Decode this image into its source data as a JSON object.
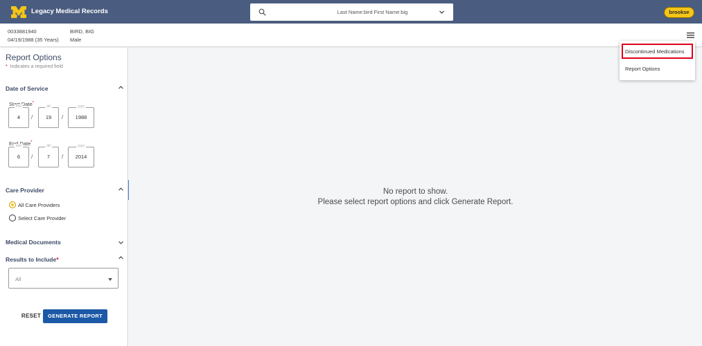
{
  "header": {
    "app_title": "Legacy Medical Records",
    "search_text": "Last Name:bird First Name:big",
    "user": "brookse",
    "colors": {
      "bar": "#4a5d80",
      "badge": "#f5c518"
    }
  },
  "patient": {
    "mrn": "0033881940",
    "name": "BIRD, BIG",
    "dob_age": "04/19/1988 (35 Years)",
    "sex": "Male"
  },
  "menu": {
    "items": [
      "Discontinued Medications",
      "Report Options"
    ],
    "highlighted_index": 0
  },
  "report_options": {
    "title": "Report Options",
    "required_note": "Indicates a required field",
    "date_of_service": {
      "title": "Date of Service",
      "start_label": "Start Date",
      "end_label": "End Date",
      "placeholders": {
        "mm": "mm",
        "dd": "dd",
        "yyyy": "yyyy"
      },
      "start": {
        "mm": "4",
        "dd": "19",
        "yyyy": "1988"
      },
      "end": {
        "mm": "6",
        "dd": "7",
        "yyyy": "2014"
      },
      "separator": "/"
    },
    "care_provider": {
      "title": "Care Provider",
      "options": [
        "All Care Providers",
        "Select Care Provider"
      ],
      "selected_index": 0
    },
    "medical_documents": {
      "title": "Medical Documents"
    },
    "results_to_include": {
      "title": "Results to Include",
      "value": "All"
    },
    "reset_label": "RESET",
    "generate_label": "GENERATE REPORT"
  },
  "main": {
    "empty_line1": "No report to show.",
    "empty_line2": "Please select report options and click Generate Report."
  },
  "icons": [
    "m-logo-icon",
    "search-icon",
    "chevron-down-icon",
    "hamburger-menu-icon",
    "chevron-up-icon",
    "chevron-left-icon",
    "caret-down-icon"
  ]
}
